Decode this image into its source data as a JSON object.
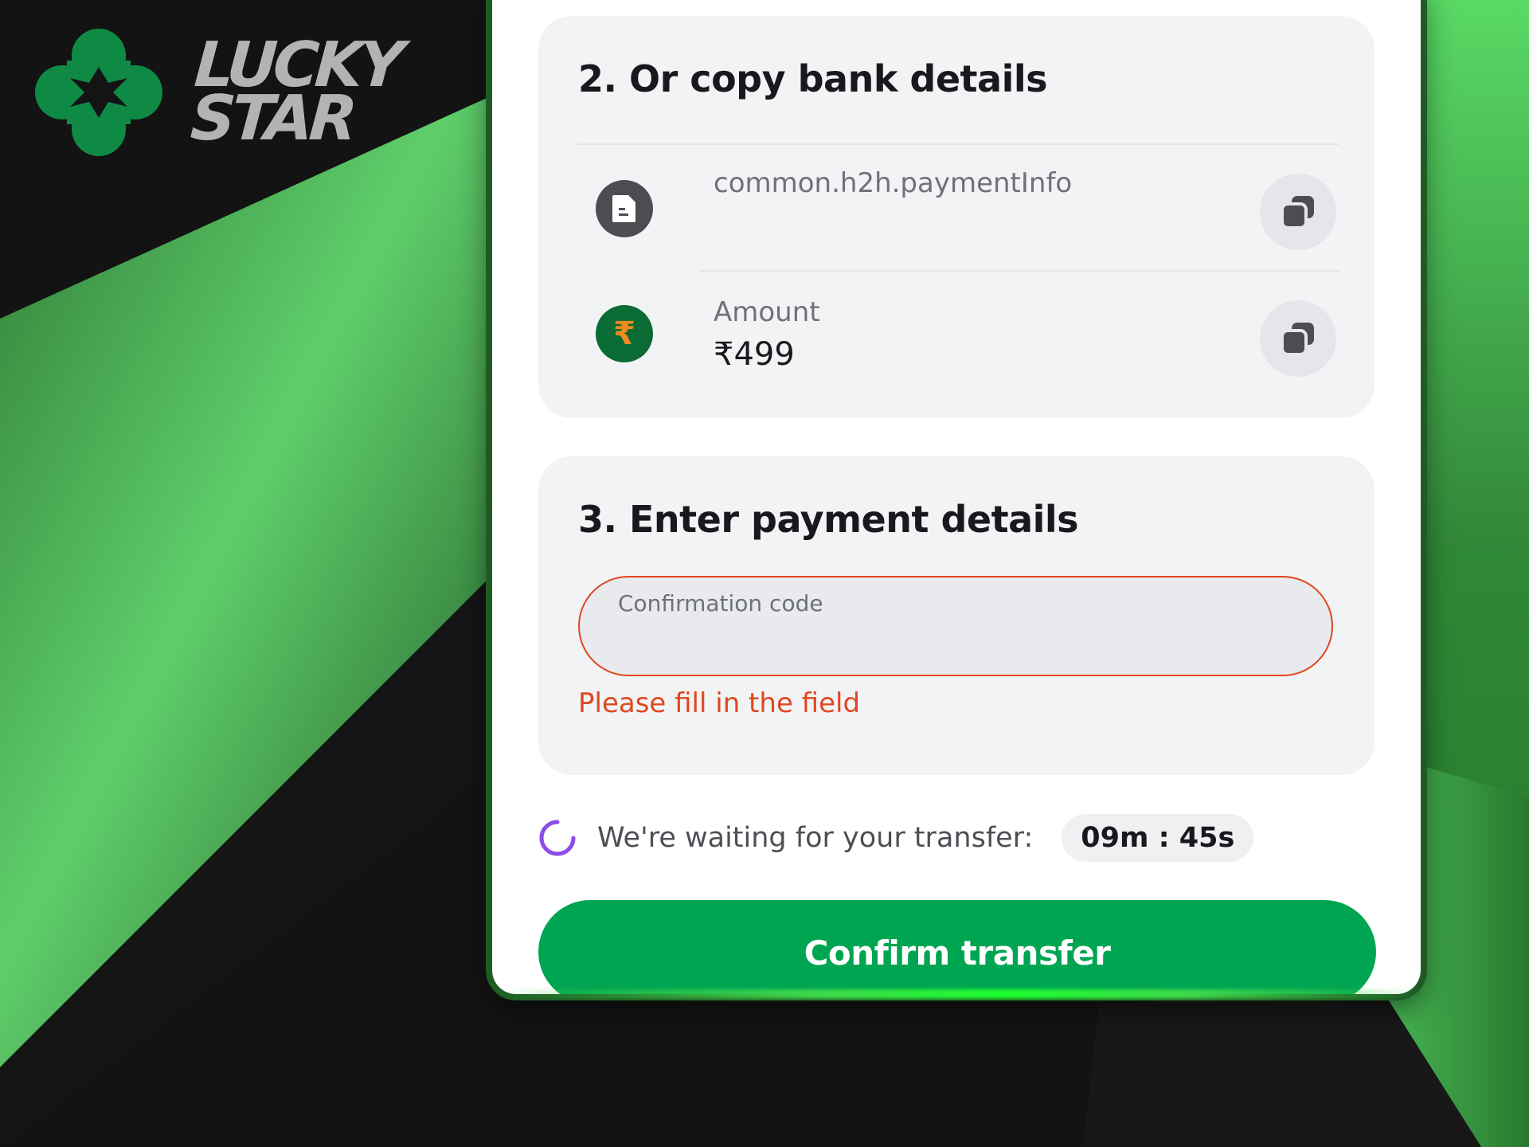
{
  "brand": {
    "line1": "LUCKY",
    "line2": "STAR",
    "logo_icon": "clover-star-icon",
    "accent_color": "#0aa04a"
  },
  "bank_section": {
    "title": "2. Or copy bank details",
    "rows": [
      {
        "icon": "document-icon",
        "label": "common.h2h.paymentInfo",
        "value": "",
        "copy_icon": "copy-icon"
      },
      {
        "icon": "rupee-icon",
        "icon_glyph": "₹",
        "label": "Amount",
        "value": "₹499",
        "copy_icon": "copy-icon"
      }
    ]
  },
  "payment_section": {
    "title": "3. Enter payment details",
    "field_label": "Confirmation code",
    "field_value": "",
    "error": "Please fill in the field",
    "error_color": "#e0471f"
  },
  "waiting": {
    "text": "We're waiting for your transfer:",
    "timer": "09m : 45s",
    "spinner_color": "#8b4ce8"
  },
  "confirm_button": {
    "label": "Confirm transfer",
    "color": "#00a552"
  }
}
